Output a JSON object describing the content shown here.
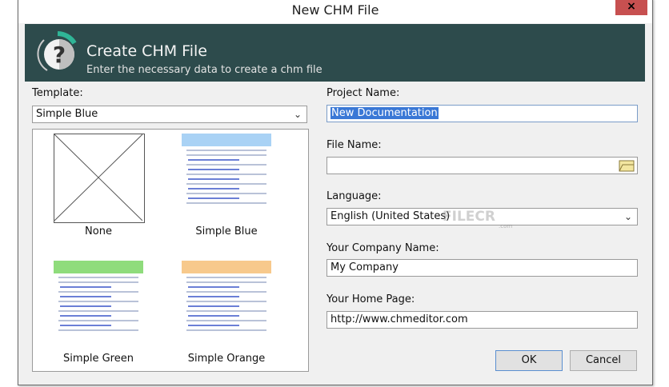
{
  "window": {
    "title": "New CHM File",
    "close_label": "×"
  },
  "header": {
    "title": "Create CHM File",
    "subtitle": "Enter the necessary data to create a chm file"
  },
  "template": {
    "label": "Template:",
    "value": "Simple Blue",
    "items": [
      {
        "label": "None"
      },
      {
        "label": "Simple Blue",
        "color": "#a9d2f5"
      },
      {
        "label": "Simple Green",
        "color": "#8fdc7c"
      },
      {
        "label": "Simple Orange",
        "color": "#f7c98c"
      }
    ]
  },
  "form": {
    "project_name": {
      "label": "Project Name:",
      "value": "New Documentation"
    },
    "file_name": {
      "label": "File Name:",
      "value": ""
    },
    "language": {
      "label": "Language:",
      "value": "English (United States)"
    },
    "company": {
      "label": "Your Company Name:",
      "value": "My Company"
    },
    "home_page": {
      "label": "Your Home Page:",
      "value": "http://www.chmeditor.com"
    }
  },
  "buttons": {
    "ok": "OK",
    "cancel": "Cancel"
  },
  "watermark": {
    "text": "FILECR",
    "sub": ".com"
  }
}
